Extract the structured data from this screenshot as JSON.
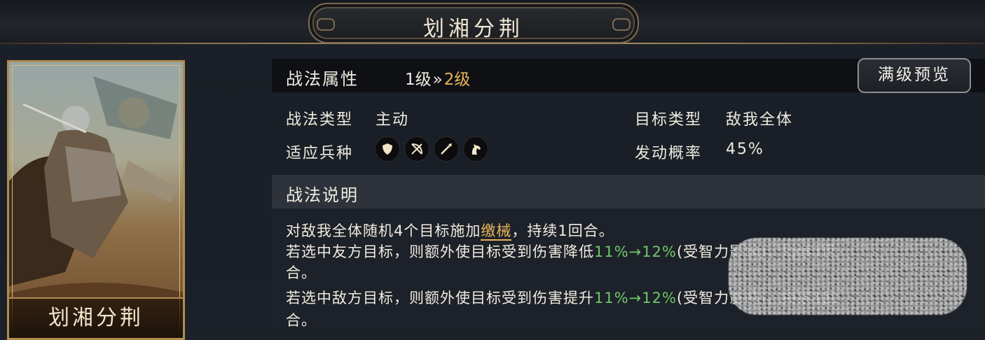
{
  "title": "划湘分荆",
  "card": {
    "name": "划湘分荆"
  },
  "attr": {
    "header_label": "战法属性",
    "level_from": "1级",
    "level_arrow": "»",
    "level_to": "2级",
    "preview_button": "满级预览",
    "type_label": "战法类型",
    "type_value": "主动",
    "target_label": "目标类型",
    "target_value": "敌我全体",
    "troops_label": "适应兵种",
    "troop_icons": [
      "shield-icon",
      "bow-icon",
      "spear-icon",
      "horse-icon"
    ],
    "rate_label": "发动概率",
    "rate_value": "45%"
  },
  "desc": {
    "header_label": "战法说明",
    "line1_a": "对敌我全体随机4个目标施加",
    "line1_kw": "缴械",
    "line1_b": "，持续1回合。",
    "line2_a": "若选中友方目标，则额外使目标受到伤害降低",
    "line2_green": "11%→12%",
    "line2_b": "(受智力影响)，持续1回",
    "line3": "合。",
    "line4_a": "若选中敌方目标，则额外使目标受到伤害提升",
    "line4_green": "11%→12%",
    "line4_b": "(受智力影响)，持续1回",
    "line5": "合。"
  },
  "colors": {
    "accent_gold": "#e8b45a",
    "value_green": "#6fc76a",
    "frame_gold": "#b08d4f"
  }
}
